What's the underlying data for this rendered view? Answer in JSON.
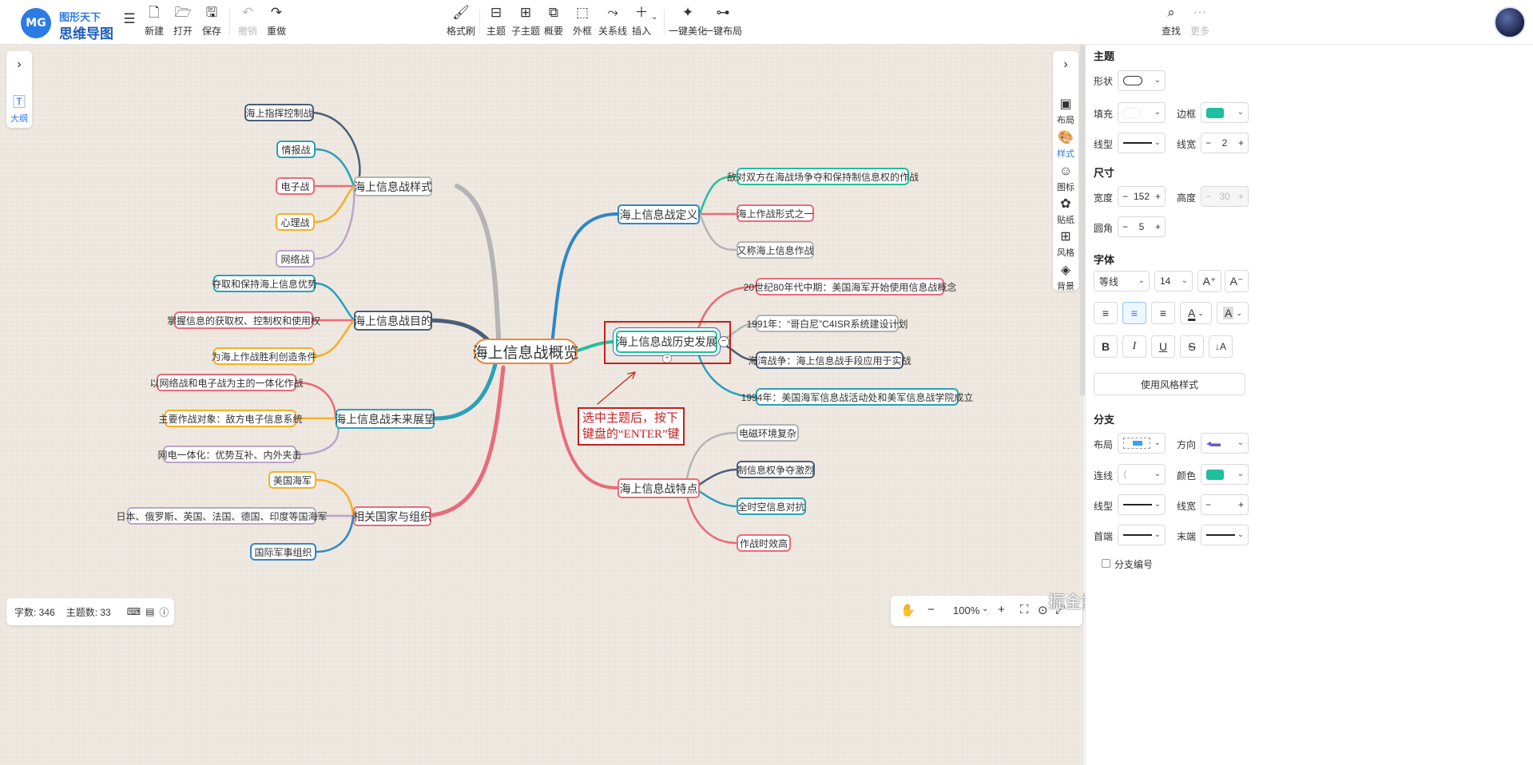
{
  "toolbar": {
    "logo": {
      "mark": "MG",
      "line1": "图形天下",
      "line2": "思维导图"
    },
    "file": [
      {
        "label": "新建",
        "icon": "new-file-icon"
      },
      {
        "label": "打开",
        "icon": "open-folder-icon"
      },
      {
        "label": "保存",
        "icon": "save-icon"
      }
    ],
    "history": [
      {
        "label": "撤销",
        "icon": "undo-icon"
      },
      {
        "label": "重做",
        "icon": "redo-icon"
      }
    ],
    "center": [
      {
        "label": "格式刷",
        "icon": "format-brush-icon"
      },
      {
        "label": "主题",
        "icon": "topic-icon"
      },
      {
        "label": "子主题",
        "icon": "subtopic-icon"
      },
      {
        "label": "概要",
        "icon": "summary-icon"
      },
      {
        "label": "外框",
        "icon": "boundary-icon"
      },
      {
        "label": "关系线",
        "icon": "relationship-icon"
      },
      {
        "label": "插入",
        "icon": "insert-icon"
      },
      {
        "label": "一键美化",
        "icon": "beautify-icon"
      },
      {
        "label": "一键布局",
        "icon": "auto-layout-icon"
      }
    ],
    "right": [
      {
        "label": "查找",
        "icon": "search-icon"
      },
      {
        "label": "更多",
        "icon": "more-icon"
      }
    ]
  },
  "sidebar_left": {
    "outline_label": "大纲"
  },
  "sidebar_right": {
    "items": [
      {
        "label": "布局"
      },
      {
        "label": "样式"
      },
      {
        "label": "图标"
      },
      {
        "label": "贴纸"
      },
      {
        "label": "风格"
      },
      {
        "label": "背景"
      }
    ]
  },
  "mindmap": {
    "root": "海上信息战概览",
    "branches": {
      "style": "海上信息战样式",
      "goal": "海上信息战目的",
      "future": "海上信息战未来展望",
      "orgs": "相关国家与组织",
      "def": "海上信息战定义",
      "history": "海上信息战历史发展",
      "features": "海上信息战特点"
    },
    "leaves": {
      "style": [
        "海上指挥控制战",
        "情报战",
        "电子战",
        "心理战",
        "网络战"
      ],
      "goal": [
        "夺取和保持海上信息优势",
        "掌握信息的获取权、控制权和使用权",
        "为海上作战胜利创造条件"
      ],
      "future": [
        "以网络战和电子战为主的一体化作战",
        "主要作战对象：敌方电子信息系统",
        "网电一体化：优势互补、内外夹击"
      ],
      "orgs": [
        "美国海军",
        "日本、俄罗斯、英国、法国、德国、印度等国海军",
        "国际军事组织"
      ],
      "def": [
        "敌对双方在海战场争夺和保持制信息权的作战",
        "海上作战形式之一",
        "又称海上信息作战"
      ],
      "history": [
        "20世纪80年代中期：美国海军开始使用信息战概念",
        "1991年：“哥白尼”C4ISR系统建设计划",
        "海湾战争：海上信息战手段应用于实战",
        "1994年：美国海军信息战活动处和美军信息战学院成立"
      ],
      "features": [
        "电磁环境复杂",
        "制信息权争夺激烈",
        "全时空信息对抗",
        "作战时效高"
      ]
    },
    "collapse_symbol": "−",
    "add_symbol": "+",
    "annotation": {
      "line1": "选中主题后，按下",
      "line2": "键盘的“ENTER”键"
    },
    "colors": {
      "root_border": "#e8883a",
      "annotation": "#c81e1e"
    }
  },
  "status": {
    "word_count": "字数: 346",
    "topic_count": "主题数: 33"
  },
  "zoom": {
    "minus": "−",
    "value": "100%",
    "plus": "+"
  },
  "watermark": "掘金技术社区 @ 图形天下",
  "props": {
    "topic": {
      "title": "主题",
      "shape_label": "形状",
      "fill_label": "填充",
      "border_label": "边框",
      "border_color": "#1fbfa0",
      "line_type_label": "线型",
      "line_width_label": "线宽",
      "line_width": "2"
    },
    "size": {
      "title": "尺寸",
      "width_label": "宽度",
      "width": "152",
      "height_label": "高度",
      "height": "30",
      "radius_label": "圆角",
      "radius": "5"
    },
    "font": {
      "title": "字体",
      "family": "等线",
      "size": "14",
      "grow": "A⁺",
      "shrink": "A⁻",
      "color_label": "A",
      "bg_label": "A",
      "bold": "B",
      "italic": "I",
      "underline": "U",
      "strike": "S",
      "case": "↓A"
    },
    "style_button": "使用风格样式",
    "branch": {
      "title": "分支",
      "layout_label": "布局",
      "direction_label": "方向",
      "connector_label": "连线",
      "color_label": "颜色",
      "branch_color": "#1fbfa0",
      "line_type_label": "线型",
      "line_width_label": "线宽",
      "start_label": "首端",
      "end_label": "末端",
      "numbering_label": "分支编号"
    },
    "minus": "−",
    "plus": "+"
  }
}
